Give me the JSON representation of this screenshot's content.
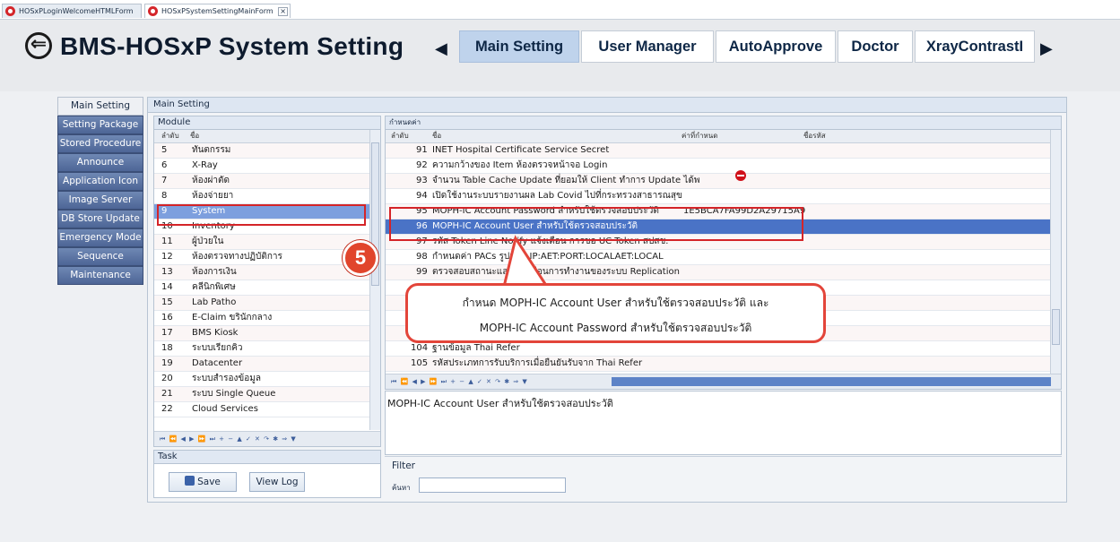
{
  "doc_tabs": [
    {
      "label": "HOSxPLoginWelcomeHTMLForm"
    },
    {
      "label": "HOSxPSystemSettingMainForm",
      "close": "×"
    }
  ],
  "header": {
    "back_icon": "⇐",
    "title": "BMS-HOSxP System Setting",
    "prev_arrow": "◀",
    "next_arrow": "▶",
    "tabs": [
      "Main Setting",
      "User Manager",
      "AutoApprove",
      "Doctor",
      "XrayContrastI"
    ]
  },
  "leftnav": [
    "Main Setting",
    "Setting Package",
    "Stored Procedure",
    "Announce",
    "Application Icon",
    "Image Server",
    "DB Store Update",
    "Emergency Mode",
    "Sequence",
    "Maintenance"
  ],
  "panel_title": "Main Setting",
  "module": {
    "title": "Module",
    "col_no": "ลำดับ",
    "col_name": "ชื่อ",
    "rows": [
      {
        "no": "5",
        "name": "ทันตกรรม"
      },
      {
        "no": "6",
        "name": "X-Ray"
      },
      {
        "no": "7",
        "name": "ห้องผ่าตัด"
      },
      {
        "no": "8",
        "name": "ห้องจ่ายยา"
      },
      {
        "no": "9",
        "name": "System"
      },
      {
        "no": "10",
        "name": "Inventory"
      },
      {
        "no": "11",
        "name": "ผู้ป่วยใน"
      },
      {
        "no": "12",
        "name": "ห้องตรวจทางปฏิบัติการ"
      },
      {
        "no": "13",
        "name": "ห้องการเงิน"
      },
      {
        "no": "14",
        "name": "คลีนิกพิเศษ"
      },
      {
        "no": "15",
        "name": "Lab Patho"
      },
      {
        "no": "16",
        "name": "E-Claim ขรินักกลาง"
      },
      {
        "no": "17",
        "name": "BMS Kiosk"
      },
      {
        "no": "18",
        "name": "ระบบเรียกคิว"
      },
      {
        "no": "19",
        "name": "Datacenter"
      },
      {
        "no": "20",
        "name": "ระบบสำรองข้อมูล"
      },
      {
        "no": "21",
        "name": "ระบบ Single Queue"
      },
      {
        "no": "22",
        "name": "Cloud Services"
      }
    ],
    "nav": "⏮ ⏪ ◀ ▶ ⏩ ⏭ + − ▲ ✓ ✕ ↷ ✱ ⇒ ▼"
  },
  "task": {
    "title": "Task",
    "save": "Save",
    "viewlog": "View Log"
  },
  "setting": {
    "title": "กำหนดค่า",
    "col_no": "ลำดับ",
    "col_name": "ชื่อ",
    "col_value": "ค่าที่กำหนด",
    "col_code": "ชื่อรหัส",
    "rows": [
      {
        "no": "91",
        "name": "INET Hospital Certificate Service Secret",
        "value": ""
      },
      {
        "no": "92",
        "name": "ความกว้างของ Item ห้องตรวจหน้าจอ Login",
        "value": ""
      },
      {
        "no": "93",
        "name": "จำนวน Table Cache Update ที่ยอมให้ Client ทำการ Update ได้พ",
        "value": ""
      },
      {
        "no": "94",
        "name": "เปิดใช้งานระบบรายงานผล Lab Covid ไปที่กระทรวงสาธารณสุข",
        "value": ""
      },
      {
        "no": "95",
        "name": "MOPH-IC Account Password สำหรับใช้ตรวจสอบประวัติ",
        "value": "1E5BCA7FA99D2A29715A9"
      },
      {
        "no": "96",
        "name": "MOPH-IC Account User สำหรับใช้ตรวจสอบประวัติ",
        "value": ""
      },
      {
        "no": "97",
        "name": "รหัส Token Line Notify แจ้งเตือน การขอ UC Token สปสช.",
        "value": ""
      },
      {
        "no": "98",
        "name": "กำหนดค่า PACs รูปแบบ IP:AET:PORT:LOCALAET:LOCAL",
        "value": ""
      },
      {
        "no": "99",
        "name": "ตรวจสอบสถานะและแจ้งเตือนการทำงานของระบบ Replication",
        "value": ""
      },
      {
        "no": "",
        "name": "",
        "value": ""
      },
      {
        "no": "",
        "name": "",
        "value": ""
      },
      {
        "no": "",
        "name": "",
        "value": ""
      },
      {
        "no": "",
        "name": "",
        "value": ""
      },
      {
        "no": "104",
        "name": "ฐานข้อมูล Thai Refer",
        "value": ""
      },
      {
        "no": "105",
        "name": "รหัสประเภทการรับบริการเมื่อยืนยันรับจาก Thai Refer",
        "value": ""
      }
    ],
    "nav": "⏮ ⏪ ◀ ▶ ⏩ ⏭ + − ▲ ✓ ✕ ↷ ✱ ⇒ ▼",
    "detail": "MOPH-IC Account User สำหรับใช้ตรวจสอบประวัติ"
  },
  "filter": {
    "title": "Filter",
    "label": "ค้นหา",
    "placeholder": ""
  },
  "annotation": {
    "step": "5",
    "line1": "กำหนด MOPH-IC Account  User สำหรับใช้ตรวจสอบประวัติ และ",
    "line2": "MOPH-IC Account  Password สำหรับใช้ตรวจสอบประวัติ"
  }
}
